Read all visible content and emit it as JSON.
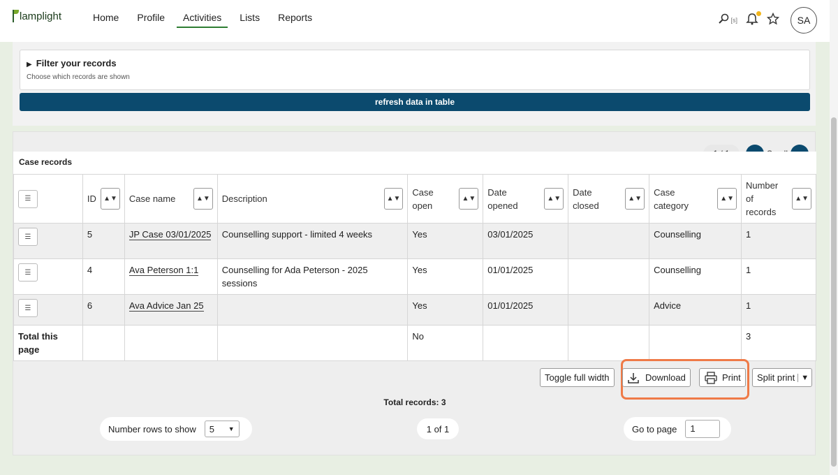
{
  "app": {
    "logo_text": "lamplight"
  },
  "nav": {
    "items": [
      "Home",
      "Profile",
      "Activities",
      "Lists",
      "Reports"
    ],
    "active": "Activities"
  },
  "header": {
    "search_shortcut": "[s]",
    "avatar_initials": "SA"
  },
  "filter": {
    "title": "Filter your records",
    "subtitle": "Choose which records are shown",
    "refresh_label": "refresh data in table"
  },
  "records": {
    "title": "Case records",
    "page_indicator": "1 / 1",
    "scroll_label": "Scroll",
    "columns": [
      "ID",
      "Case name",
      "Description",
      "Case open",
      "Date opened",
      "Date closed",
      "Case category",
      "Number of records"
    ],
    "rows": [
      {
        "id": "5",
        "case_name": "JP Case 03/01/2025",
        "description": "Counselling support - limited 4 weeks",
        "case_open": "Yes",
        "date_opened": "03/01/2025",
        "date_closed": "",
        "case_category": "Counselling",
        "num_records": "1"
      },
      {
        "id": "4",
        "case_name": "Ava Peterson 1:1",
        "description": "Counselling for Ada Peterson - 2025 sessions",
        "case_open": "Yes",
        "date_opened": "01/01/2025",
        "date_closed": "",
        "case_category": "Counselling",
        "num_records": "1"
      },
      {
        "id": "6",
        "case_name": "Ava Advice Jan 25",
        "description": "",
        "case_open": "Yes",
        "date_opened": "01/01/2025",
        "date_closed": "",
        "case_category": "Advice",
        "num_records": "1"
      }
    ],
    "total": {
      "label": "Total this page",
      "case_open": "No",
      "num_records": "3"
    },
    "actions": {
      "toggle": "Toggle full width",
      "download": "Download",
      "print": "Print",
      "split_print": "Split print"
    },
    "total_records": "Total records: 3",
    "rows_label": "Number rows to show",
    "rows_value": "5",
    "page_of": "1 of 1",
    "goto_label": "Go to page",
    "goto_value": "1"
  },
  "colors": {
    "primary": "#0b4a6e",
    "accent": "#2e7d32",
    "highlight": "#ef7a47"
  }
}
